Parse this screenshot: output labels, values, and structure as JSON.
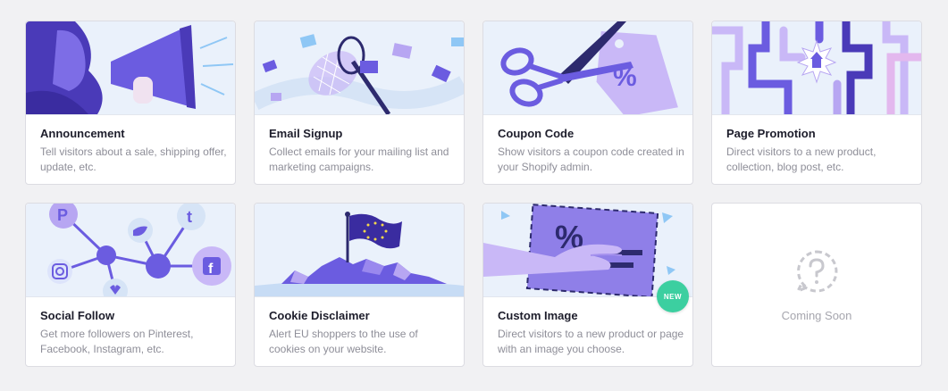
{
  "cards": [
    {
      "title": "Announcement",
      "description": "Tell visitors about a sale, shipping offer, update, etc.",
      "icon": "megaphone-illustration"
    },
    {
      "title": "Email Signup",
      "description": "Collect emails for your mailing list and marketing campaigns.",
      "icon": "envelope-net-illustration"
    },
    {
      "title": "Coupon Code",
      "description": "Show visitors a coupon code created in your Shopify admin.",
      "icon": "scissors-tag-illustration"
    },
    {
      "title": "Page Promotion",
      "description": "Direct visitors to a new product, collection, blog post, etc.",
      "icon": "pipes-illustration"
    },
    {
      "title": "Social Follow",
      "description": "Get more followers on Pinterest, Facebook, Instagram, etc.",
      "icon": "social-network-illustration"
    },
    {
      "title": "Cookie Disclaimer",
      "description": "Alert EU shoppers to the use of cookies on your website.",
      "icon": "eu-flag-illustration"
    },
    {
      "title": "Custom Image",
      "description": "Direct visitors to a new product or page with an image you choose.",
      "icon": "hand-image-illustration",
      "badge": "NEW"
    },
    {
      "title": "",
      "description": "",
      "placeholder": "Coming Soon",
      "icon": "question-icon"
    }
  ],
  "colors": {
    "accent": "#6b5ce0",
    "purple_light": "#b7a6f2",
    "badge_green": "#3ccfa0",
    "illustration_bg": "#eaf1fb"
  }
}
